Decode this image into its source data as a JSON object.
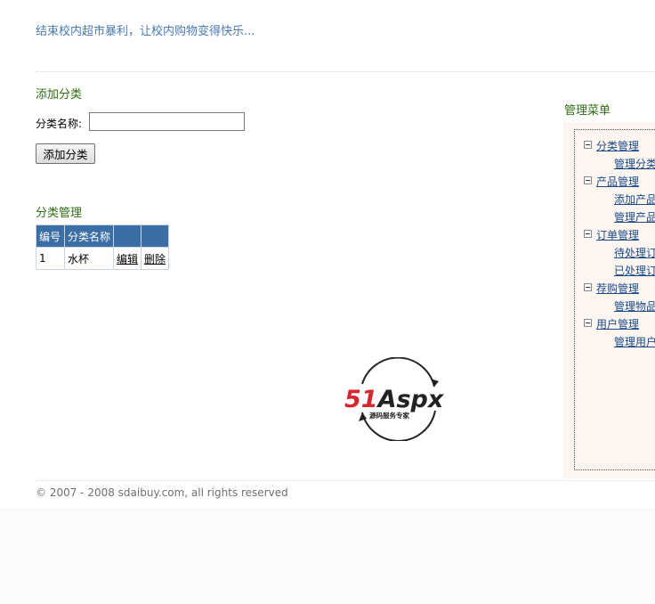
{
  "header": {
    "slogan": "结束校内超市暴利，让校内购物变得快乐..."
  },
  "add_category": {
    "title": "添加分类",
    "name_label": "分类名称:",
    "name_value": "",
    "submit_label": "添加分类"
  },
  "manage_category": {
    "title": "分类管理",
    "columns": [
      "编号",
      "分类名称",
      "",
      ""
    ],
    "rows": [
      {
        "id": "1",
        "name": "水杯",
        "edit": "编辑",
        "delete": "删除"
      }
    ]
  },
  "logo": {
    "text_main": "51Aspx",
    "text_sub": "源码服务专家"
  },
  "sidebar": {
    "title": "管理菜单",
    "groups": [
      {
        "label": "分类管理",
        "items": [
          "管理分类"
        ]
      },
      {
        "label": "产品管理",
        "items": [
          "添加产品",
          "管理产品"
        ]
      },
      {
        "label": "订单管理",
        "items": [
          "待处理订单",
          "已处理订单"
        ]
      },
      {
        "label": "荐购管理",
        "items": [
          "管理物品"
        ]
      },
      {
        "label": "用户管理",
        "items": [
          "管理用户"
        ]
      }
    ]
  },
  "footer": {
    "copyright": "© 2007 - 2008 sdaibuy.com, all rights reserved"
  },
  "colors": {
    "accent_link": "#4a7ab0",
    "section_title": "#2f6d10",
    "table_header": "#3a6ea5",
    "menu_bg": "#fdf5ef",
    "logo_red": "#d8262e",
    "logo_green": "#3a9a3a"
  }
}
